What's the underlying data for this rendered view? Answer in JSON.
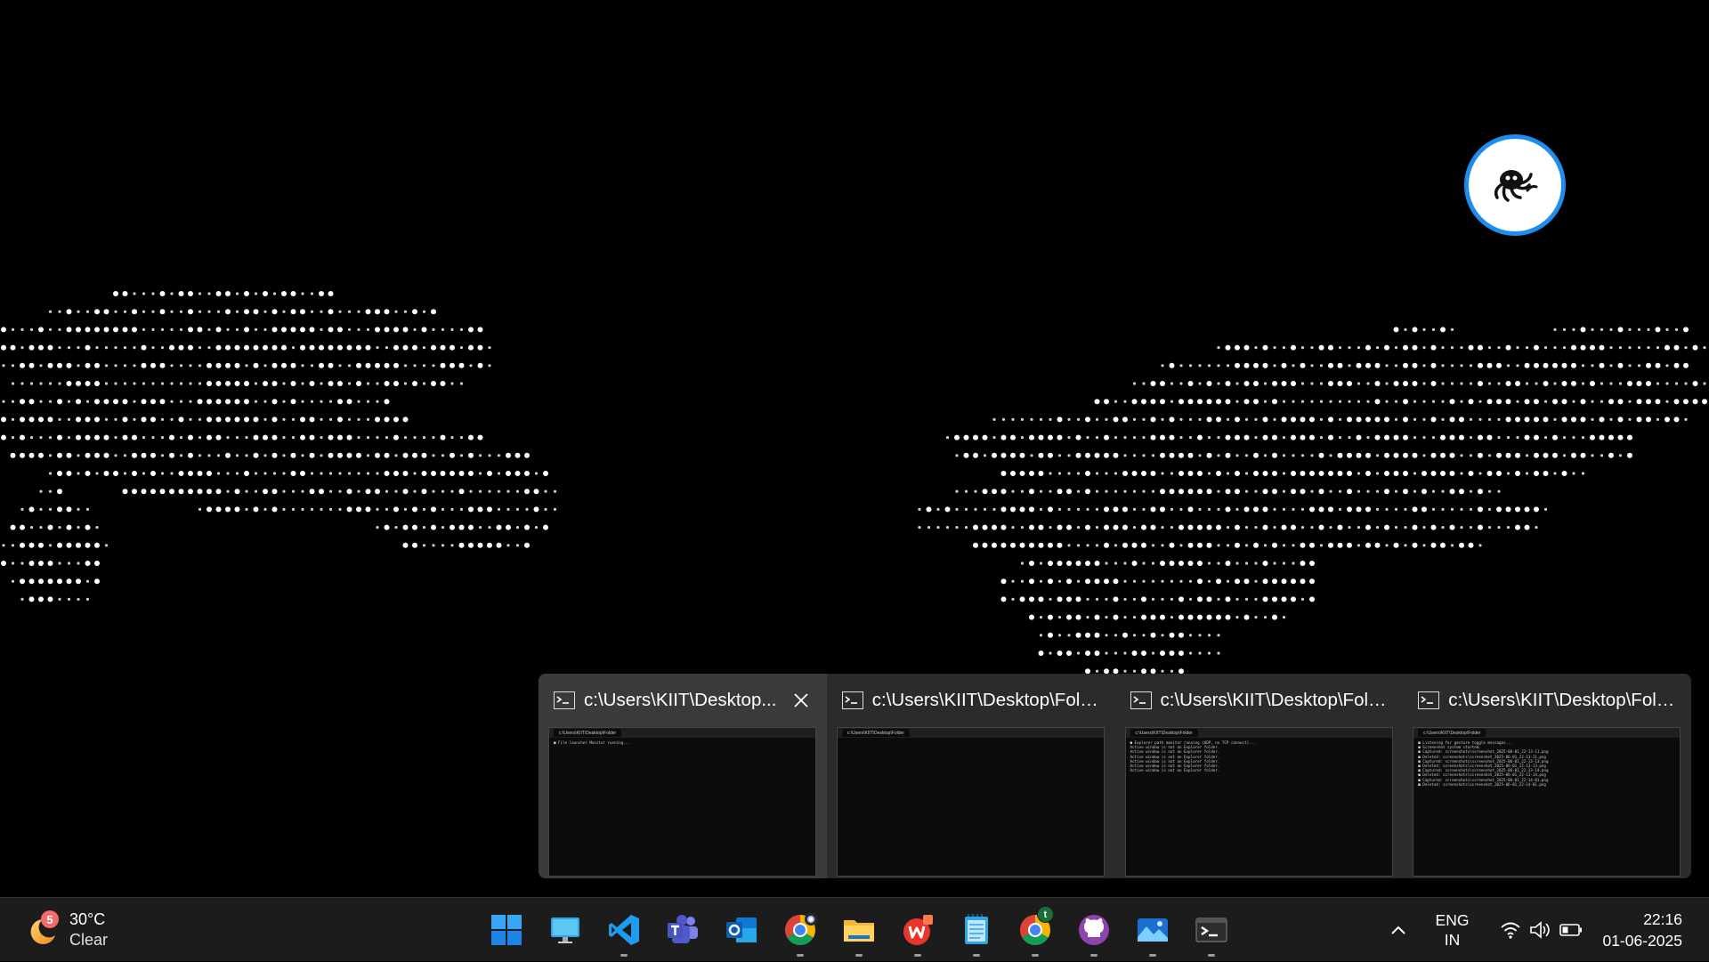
{
  "desktop": {
    "floating_avatar": {
      "icon": "octopus-icon"
    }
  },
  "preview_flyout": {
    "cards": [
      {
        "title": "c:\\Users\\KIIT\\Desktop...",
        "active": true,
        "thumb_tab": "c:\\Users\\KIIT\\Desktop\\Folder",
        "lines": [
          "■ File launcher Monitor running..."
        ]
      },
      {
        "title": "c:\\Users\\KIIT\\Desktop\\Folde...",
        "active": false,
        "thumb_tab": "c:\\Users\\KIIT\\Desktop\\Folder",
        "lines": []
      },
      {
        "title": "c:\\Users\\KIIT\\Desktop\\Folde...",
        "active": false,
        "thumb_tab": "c:\\Users\\KIIT\\Desktop\\Folder",
        "lines": [
          "■ Explorer path monitor running (UDP, no TCP connect)...",
          "Active window is not an Explorer folder.",
          "Active window is not an Explorer folder.",
          "Active window is not an Explorer folder.",
          "Active window is not an Explorer folder.",
          "Active window is not an Explorer folder.",
          "Active window is not an Explorer folder."
        ]
      },
      {
        "title": "c:\\Users\\KIIT\\Desktop\\Folde...",
        "active": false,
        "thumb_tab": "c:\\Users\\KIIT\\Desktop\\Folder",
        "lines": [
          "■ Listening for gesture toggle messages...",
          "■ Screenshot system started.",
          "■ Captured: screenshots\\screenshot_2025-06-01_22-13-11.png",
          "■ Deleted: screenshots\\screenshot_2025-06-01_22-13-11.png",
          "■ Captured: screenshots\\screenshot_2025-06-01_22-13-13.png",
          "■ Deleted: screenshots\\screenshot_2025-06-01_22-13-13.png",
          "■ Captured: screenshots\\screenshot_2025-06-01_22-13-14.png",
          "■ Deleted: screenshots\\screenshot_2025-06-01_22-13-14.png",
          "■ Captured: screenshots\\screenshot_2025-06-01_22-14-01.png",
          "■ Deleted: screenshots\\screenshot_2025-06-01_22-14-01.png"
        ]
      }
    ]
  },
  "taskbar": {
    "weather": {
      "badge": "5",
      "temperature": "30°C",
      "condition": "Clear",
      "icon": "moon-icon"
    },
    "apps": [
      {
        "name": "start",
        "icon": "windows-logo-icon",
        "running": false
      },
      {
        "name": "desktop",
        "icon": "monitor-icon",
        "running": false
      },
      {
        "name": "vscode",
        "icon": "vscode-icon",
        "running": true
      },
      {
        "name": "teams",
        "icon": "teams-icon",
        "running": false
      },
      {
        "name": "outlook",
        "icon": "outlook-icon",
        "running": false
      },
      {
        "name": "chrome-1",
        "icon": "chrome-icon",
        "running": true
      },
      {
        "name": "file-explorer",
        "icon": "folder-icon",
        "running": true
      },
      {
        "name": "wps-office",
        "icon": "wps-icon",
        "running": true
      },
      {
        "name": "notepad",
        "icon": "notepad-icon",
        "running": true
      },
      {
        "name": "chrome-2",
        "icon": "chrome-icon",
        "running": true,
        "badge": "t"
      },
      {
        "name": "github-desktop",
        "icon": "github-icon",
        "running": true
      },
      {
        "name": "photos",
        "icon": "photos-icon",
        "running": true
      },
      {
        "name": "terminal",
        "icon": "terminal-icon",
        "running": true
      }
    ],
    "tray": {
      "language_line1": "ENG",
      "language_line2": "IN",
      "time": "22:16",
      "date": "01-06-2025"
    }
  }
}
